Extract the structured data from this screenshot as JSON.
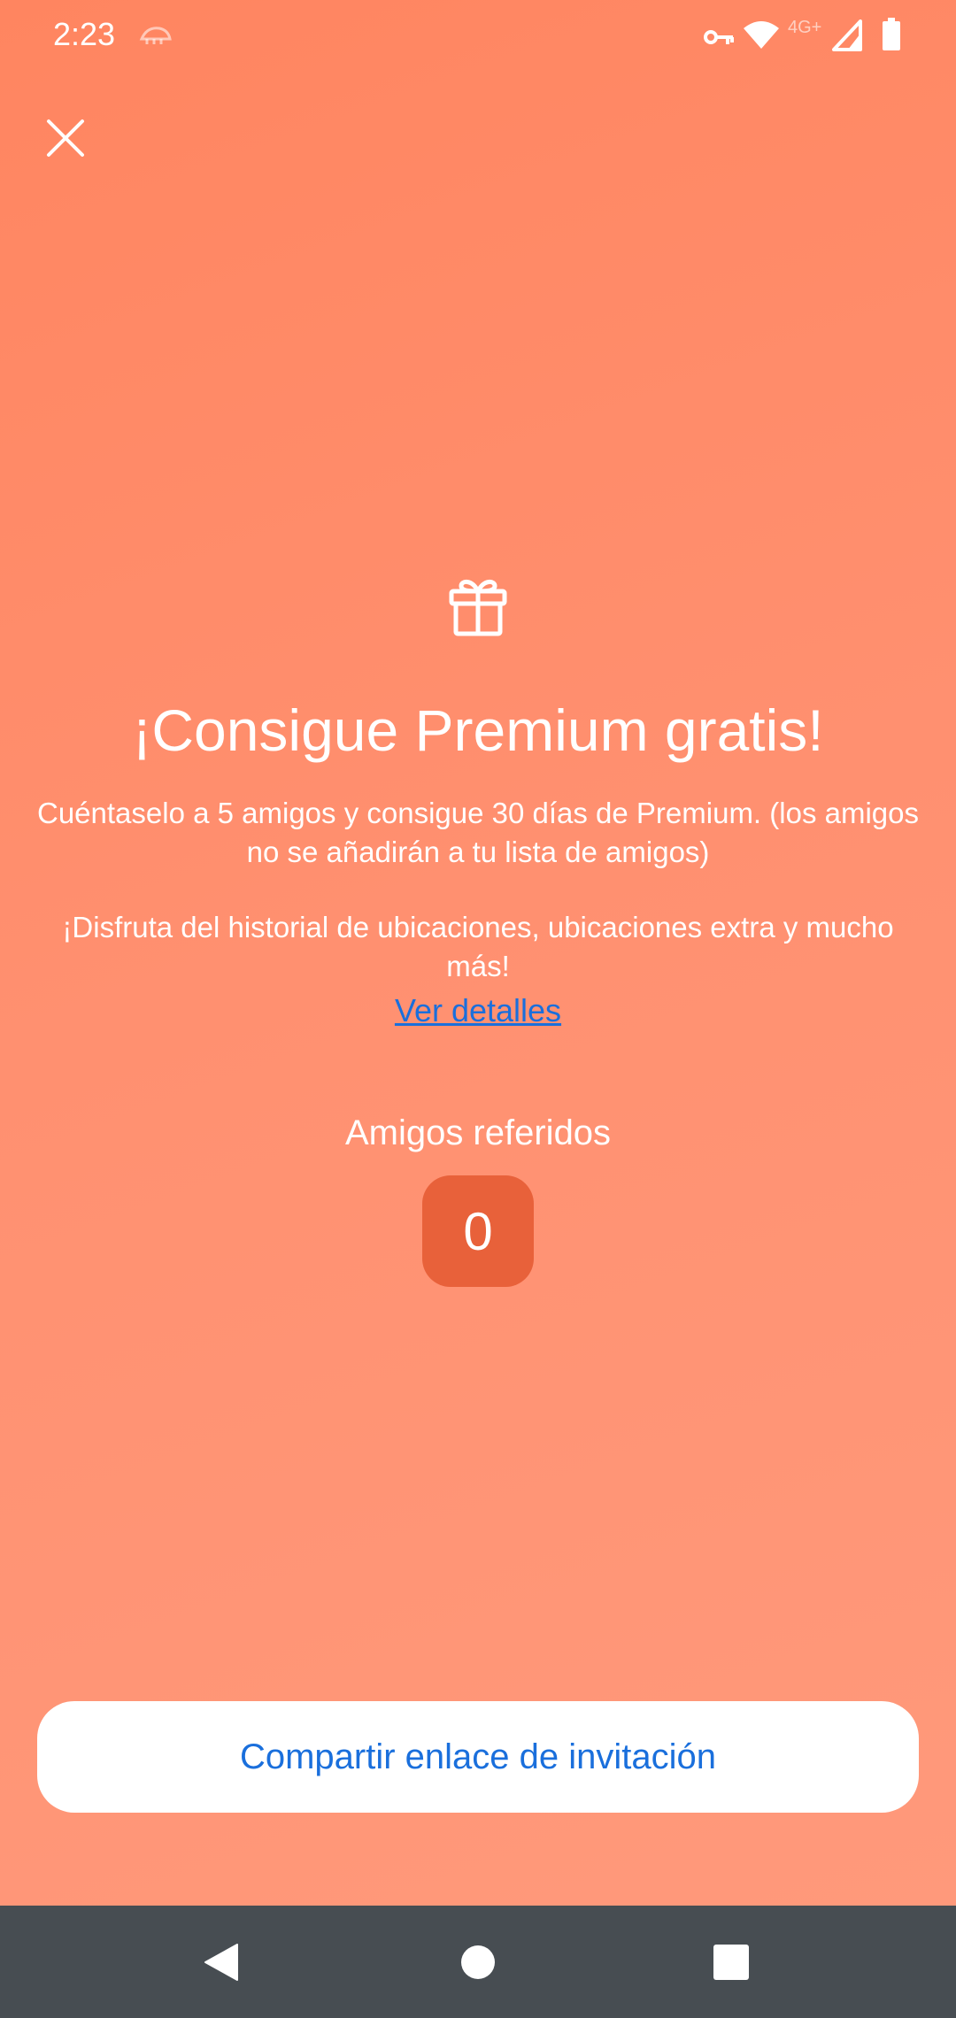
{
  "status_bar": {
    "time": "2:23",
    "network": "4G+"
  },
  "main": {
    "title": "¡Consigue Premium gratis!",
    "description": "Cuéntaselo a 5 amigos y consigue 30 días de Premium. (los amigos no se añadirán a tu lista de amigos)",
    "features": "¡Disfruta del historial de ubicaciones, ubicaciones extra y mucho más!",
    "details_link": "Ver detalles",
    "referred_label": "Amigos referidos",
    "referred_count": "0"
  },
  "actions": {
    "share_label": "Compartir enlace de invitación"
  },
  "colors": {
    "background": "#ff8d6c",
    "link": "#1a6fdc",
    "count_badge": "#e8613a",
    "nav_bar": "#474d52"
  },
  "icons": {
    "close": "close-icon",
    "gift": "gift-icon",
    "back": "back-icon",
    "home": "home-icon",
    "recents": "recents-icon"
  }
}
